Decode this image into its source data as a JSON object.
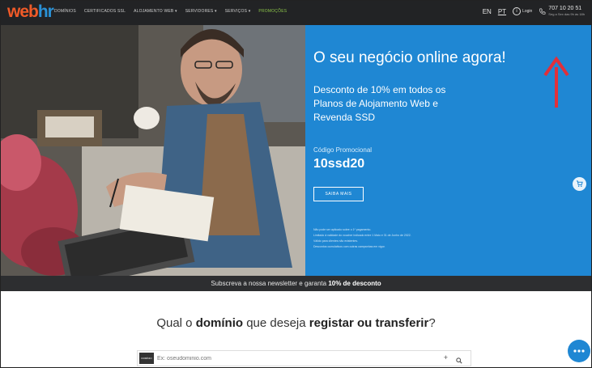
{
  "brand": {
    "logo_main": "web",
    "logo_accent": "hr"
  },
  "nav": {
    "links": [
      "DOMÍNIOS",
      "CERTIFICADOS SSL",
      "ALOJAMENTO WEB ▾",
      "SERVIDORES ▾",
      "SERVIÇOS ▾"
    ],
    "promo_label": "PROMOÇÕES",
    "lang_en": "EN",
    "lang_pt": "PT",
    "login_label": "Login",
    "phone": "707 10 20 51",
    "phone_hours": "Seg a Sex das 9h às 18h"
  },
  "hero": {
    "headline": "O seu negócio online agora!",
    "offer": "Desconto de 10% em todos os Planos de Alojamento Web e Revenda SSD",
    "code_label": "Código Promocional",
    "code": "10ssd20",
    "more_button": "SAIBA MAIS",
    "fine_print": [
      "Não pode ser aplicado sobre o 1º pagamento.",
      "Limitado à validade do voucher indicado entre 1 Maio e 31 de Junho de 2022.",
      "Válido para clientes não existentes.",
      "Descontos cumulativos com outras campanhas em vigor."
    ]
  },
  "newsletter": {
    "text": "Subscreva a nossa newsletter e garanta ",
    "bold": "10% de desconto"
  },
  "domain": {
    "q_pre": "Qual o ",
    "q_bold1": "domínio",
    "q_mid": " que deseja ",
    "q_bold2": "registar ou transferir",
    "q_end": "?",
    "tag": "DOMÍNIO",
    "placeholder": "Ex: oseudominio.com"
  },
  "colors": {
    "accent_blue": "#1f87d3",
    "logo_orange": "#f05a28",
    "arrow_red": "#e0303a",
    "promo_green": "#8bc34a"
  }
}
